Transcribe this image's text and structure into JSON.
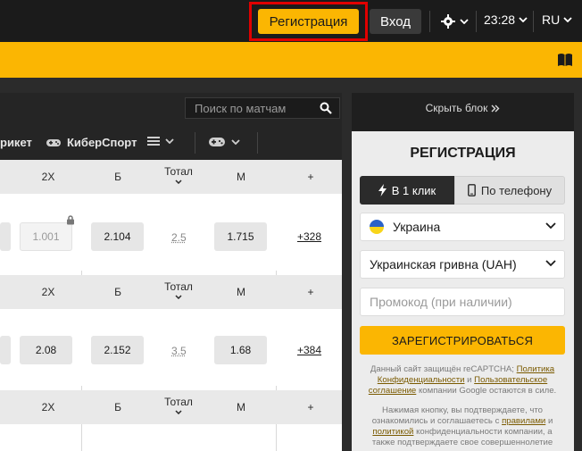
{
  "header": {
    "register_label": "Регистрация",
    "login_label": "Вход",
    "time": "23:28",
    "lang": "RU"
  },
  "icons": {
    "settings": "gear-icon",
    "chevron": "chevron-down-icon",
    "book": "book-icon",
    "search": "search-icon",
    "gamepad": "gamepad-icon",
    "menu": "list-icon",
    "lock": "lock-icon",
    "bolt": "lightning-icon",
    "phone": "phone-icon",
    "arrows": "double-chevron-right-icon"
  },
  "search": {
    "placeholder": "Поиск по матчам"
  },
  "sports": {
    "item1": "рикет",
    "item2": "КиберСпорт"
  },
  "table": {
    "headers": {
      "c2x": "2X",
      "cb": "Б",
      "ctot": "Тотал",
      "cm": "М",
      "cplus": "+"
    },
    "rows": [
      {
        "v2x": "1.001",
        "vb": "2.104",
        "tot": "2.5",
        "vm": "1.715",
        "more": "+328"
      },
      {
        "v2x": "2.08",
        "vb": "2.152",
        "tot": "3.5",
        "vm": "1.68",
        "more": "+384"
      }
    ]
  },
  "right": {
    "hide_label": "Скрыть блок",
    "title": "РЕГИСТРАЦИЯ",
    "tab_one_click": "В 1 клик",
    "tab_phone": "По телефону",
    "country": "Украина",
    "currency": "Украинская гривна (UAH)",
    "promo_placeholder": "Промокод (при наличии)",
    "submit": "ЗАРЕГИСТРИРОВАТЬСЯ",
    "captcha_1": "Данный сайт защищён reCAPTCHA;",
    "captcha_privacy": "Политика Конфиденциальности",
    "captcha_and": "и",
    "captcha_terms": "Пользовательское соглашение",
    "captcha_2": "компании Google остаются в силе.",
    "consent_1": "Нажимая кнопку, вы подтверждаете, что ознакомились и соглашаетесь с",
    "consent_rules": "правилами",
    "consent_and": "и",
    "consent_policy": "политикой",
    "consent_2": "конфиденциальности компании, а также подтверждаете свое совершеннолетие"
  },
  "colors": {
    "accent": "#fbb602",
    "dark": "#1b1b1b",
    "highlight": "#e00000"
  }
}
